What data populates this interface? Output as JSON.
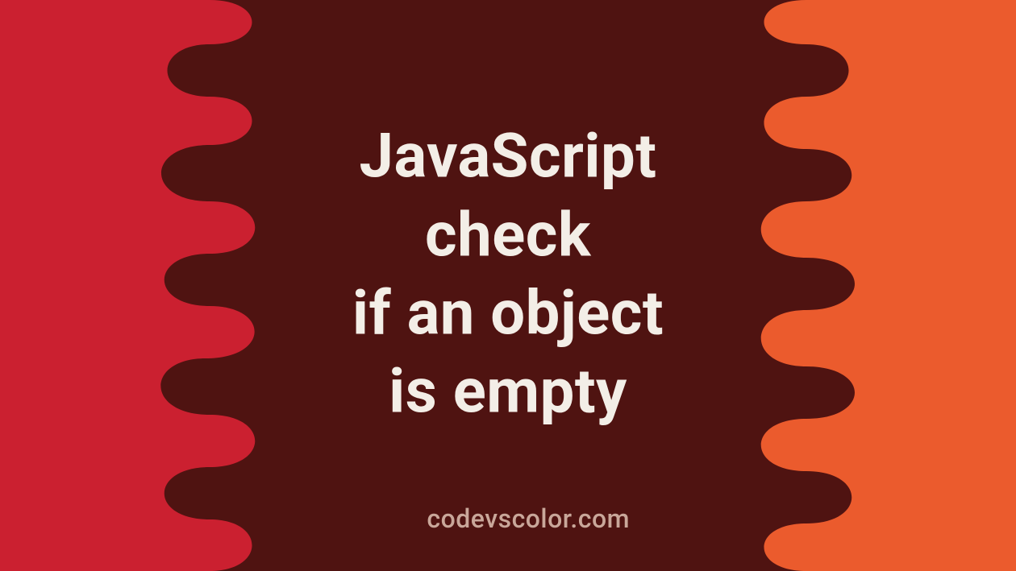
{
  "title": {
    "line1": "JavaScript",
    "line2": "check",
    "line3": "if an object",
    "line4": "is empty"
  },
  "credit": "codevscolor.com",
  "colors": {
    "background_center": "#4f1311",
    "left_band": "#cb2030",
    "right_band": "#eb5b2d",
    "text": "#f3eee7",
    "credit": "#c9a79a"
  }
}
